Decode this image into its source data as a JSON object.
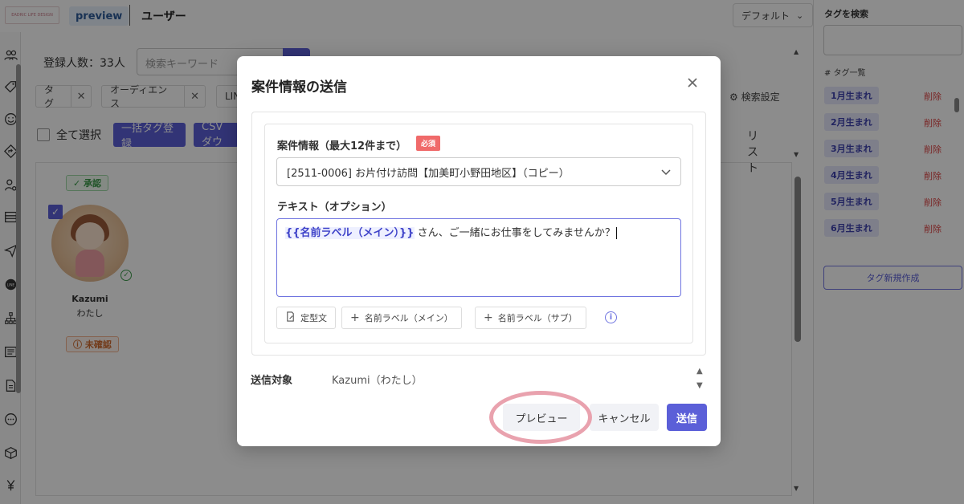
{
  "app": {
    "logo_text": "EADRIC LIFE DESIGN",
    "preview_pill": "preview",
    "page_title": "ユーザー",
    "default_select": "デフォルト"
  },
  "toolbar": {
    "count_label": "登録人数：33人",
    "search_placeholder": "検索キーワード",
    "filters": [
      "タグ",
      "オーディエンス",
      "LIN"
    ],
    "search_settings": "検索設定",
    "select_all": "全て選択",
    "bulk_tag": "一括タグ登録",
    "csv": "CSVダウ",
    "view_list": "リスト"
  },
  "content": {
    "approved_badge": "承認",
    "unconfirmed_badge": "未確認",
    "user_name": "Kazumi",
    "user_sub": "わたし"
  },
  "sidebar": {
    "search_title": "タグを検索",
    "list_title": "# タグ一覧",
    "tags": [
      "1月生まれ",
      "2月生まれ",
      "3月生まれ",
      "4月生まれ",
      "5月生まれ",
      "6月生まれ"
    ],
    "delete_label": "削除",
    "new_tag": "タグ新規作成"
  },
  "modal": {
    "title": "案件情報の送信",
    "field1_label": "案件情報（最大12件まで）",
    "required_badge": "必須",
    "select_value": "[2511-0006] お片付け訪問【加美町小野田地区】（コピー）",
    "field2_label": "テキスト（オプション）",
    "text_variable": "{{名前ラベル（メイン）}}",
    "text_body": "さん、ご一緒にお仕事をしてみませんか？",
    "tool_template": "定型文",
    "tool_name_main": "名前ラベル（メイン）",
    "tool_name_sub": "名前ラベル（サブ）",
    "target_label": "送信対象",
    "target_value": "Kazumi（わたし）",
    "preview_button": "プレビュー",
    "cancel_button": "キャンセル",
    "send_button": "送信"
  },
  "colors": {
    "accent": "#5b5fd8",
    "required": "#f06a6a",
    "delete": "#dd4444",
    "highlight_ring": "#e9a2ae"
  }
}
